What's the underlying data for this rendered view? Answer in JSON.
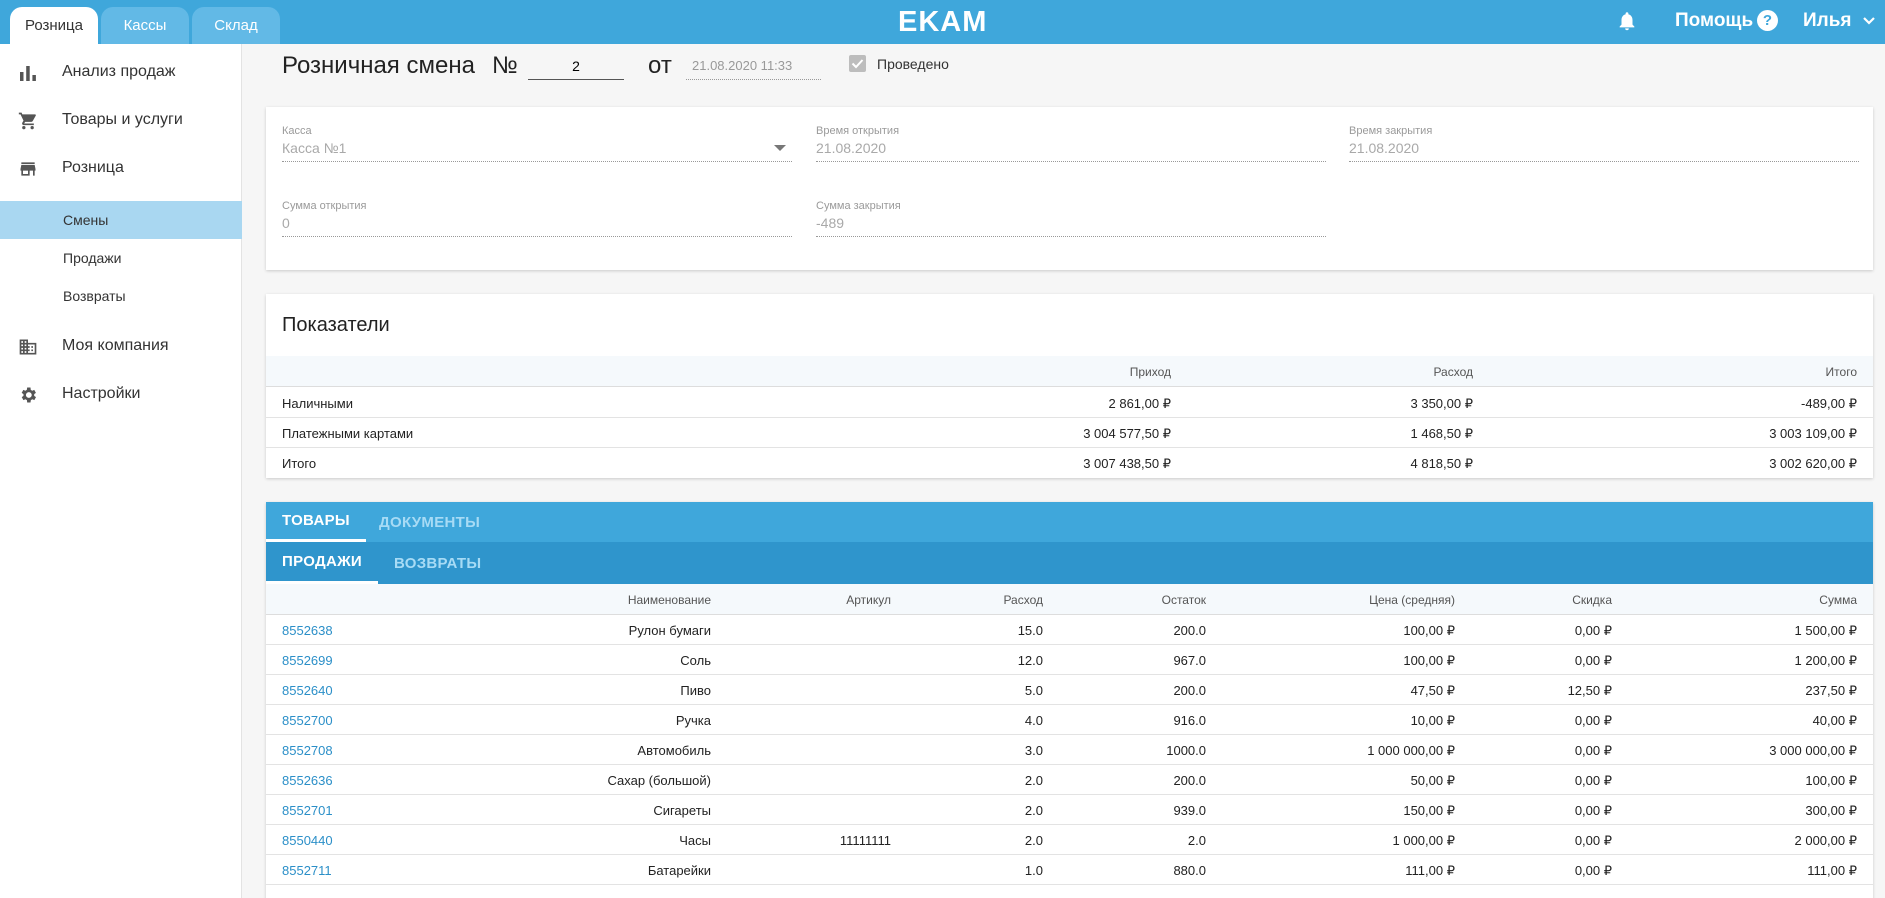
{
  "topbar": {
    "tabs": [
      "Розница",
      "Кассы",
      "Склад"
    ],
    "logo": "EKAM",
    "help_label": "Помощь",
    "help_icon": "?",
    "user_label": "Илья"
  },
  "sidebar": {
    "items": [
      {
        "label": "Анализ продаж",
        "icon": "bar-chart-icon"
      },
      {
        "label": "Товары и услуги",
        "icon": "cart-icon"
      },
      {
        "label": "Розница",
        "icon": "store-icon"
      },
      {
        "label": "Моя компания",
        "icon": "building-icon"
      },
      {
        "label": "Настройки",
        "icon": "gear-icon"
      }
    ],
    "subitems": [
      {
        "label": "Смены",
        "active": true
      },
      {
        "label": "Продажи",
        "active": false
      },
      {
        "label": "Возвраты",
        "active": false
      }
    ]
  },
  "header": {
    "title": "Розничная смена",
    "number_sign": "№",
    "number": "2",
    "from_label": "от",
    "date": "21.08.2020 11:33",
    "posted_label": "Проведено",
    "posted": true
  },
  "info": {
    "register_label": "Касса",
    "register_value": "Касса №1",
    "open_time_label": "Время открытия",
    "open_time_value": "21.08.2020",
    "close_time_label": "Время закрытия",
    "close_time_value": "21.08.2020",
    "open_sum_label": "Сумма открытия",
    "open_sum_value": "0",
    "close_sum_label": "Сумма закрытия",
    "close_sum_value": "-489"
  },
  "kpi": {
    "title": "Показатели",
    "columns": [
      "Приход",
      "Расход",
      "Итого"
    ],
    "rows": [
      {
        "name": "Наличными",
        "income": "2 861,00 ₽",
        "expense": "3 350,00 ₽",
        "total": "-489,00 ₽"
      },
      {
        "name": "Платежными картами",
        "income": "3 004 577,50 ₽",
        "expense": "1 468,50 ₽",
        "total": "3 003 109,00 ₽"
      },
      {
        "name": "Итого",
        "income": "3 007 438,50 ₽",
        "expense": "4 818,50 ₽",
        "total": "3 002 620,00 ₽"
      }
    ]
  },
  "goods": {
    "tabs": [
      "ТОВАРЫ",
      "ДОКУМЕНТЫ"
    ],
    "subtabs": [
      "ПРОДАЖИ",
      "ВОЗВРАТЫ"
    ],
    "columns": [
      "Наименование",
      "Артикул",
      "Расход",
      "Остаток",
      "Цена (средняя)",
      "Скидка",
      "Сумма"
    ],
    "rows": [
      {
        "id": "8552638",
        "name": "Рулон бумаги",
        "sku": "",
        "qty": "15.0",
        "stock": "200.0",
        "price": "100,00 ₽",
        "discount": "0,00 ₽",
        "sum": "1 500,00 ₽"
      },
      {
        "id": "8552699",
        "name": "Соль",
        "sku": "",
        "qty": "12.0",
        "stock": "967.0",
        "price": "100,00 ₽",
        "discount": "0,00 ₽",
        "sum": "1 200,00 ₽"
      },
      {
        "id": "8552640",
        "name": "Пиво",
        "sku": "",
        "qty": "5.0",
        "stock": "200.0",
        "price": "47,50 ₽",
        "discount": "12,50 ₽",
        "sum": "237,50 ₽"
      },
      {
        "id": "8552700",
        "name": "Ручка",
        "sku": "",
        "qty": "4.0",
        "stock": "916.0",
        "price": "10,00 ₽",
        "discount": "0,00 ₽",
        "sum": "40,00 ₽"
      },
      {
        "id": "8552708",
        "name": "Автомобиль",
        "sku": "",
        "qty": "3.0",
        "stock": "1000.0",
        "price": "1 000 000,00 ₽",
        "discount": "0,00 ₽",
        "sum": "3 000 000,00 ₽"
      },
      {
        "id": "8552636",
        "name": "Сахар (большой)",
        "sku": "",
        "qty": "2.0",
        "stock": "200.0",
        "price": "50,00 ₽",
        "discount": "0,00 ₽",
        "sum": "100,00 ₽"
      },
      {
        "id": "8552701",
        "name": "Сигареты",
        "sku": "",
        "qty": "2.0",
        "stock": "939.0",
        "price": "150,00 ₽",
        "discount": "0,00 ₽",
        "sum": "300,00 ₽"
      },
      {
        "id": "8550440",
        "name": "Часы",
        "sku": "11111111",
        "qty": "2.0",
        "stock": "2.0",
        "price": "1 000,00 ₽",
        "discount": "0,00 ₽",
        "sum": "2 000,00 ₽"
      },
      {
        "id": "8552711",
        "name": "Батарейки",
        "sku": "",
        "qty": "1.0",
        "stock": "880.0",
        "price": "111,00 ₽",
        "discount": "0,00 ₽",
        "sum": "111,00 ₽"
      }
    ]
  },
  "colors": {
    "primary": "#3fa7db",
    "subtab_bar": "#2f95cc",
    "active_nav": "#a9d7f1",
    "link": "#2b8fc8"
  }
}
